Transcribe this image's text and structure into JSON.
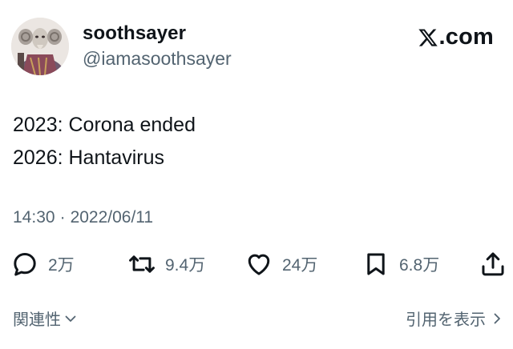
{
  "author": {
    "display_name": "soothsayer",
    "handle": "@iamasoothsayer",
    "avatar_icon": "soothsayer-avatar-image"
  },
  "brand": {
    "logo_icon": "x-logo-icon",
    "logo_text": ".com"
  },
  "tweet": {
    "lines": [
      "2023: Corona ended",
      "2026: Hantavirus"
    ]
  },
  "meta": {
    "time": "14:30",
    "separator": "·",
    "date": "2022/06/11"
  },
  "actions": {
    "reply": {
      "icon": "reply-icon",
      "count": "2万"
    },
    "retweet": {
      "icon": "retweet-icon",
      "count": "9.4万"
    },
    "like": {
      "icon": "heart-icon",
      "count": "24万"
    },
    "bookmark": {
      "icon": "bookmark-icon",
      "count": "6.8万"
    },
    "share": {
      "icon": "share-icon"
    }
  },
  "footer": {
    "related_label": "関連性",
    "quote_label": "引用を表示"
  },
  "colors": {
    "text_primary": "#0f1419",
    "text_secondary": "#536471",
    "background": "#ffffff"
  }
}
